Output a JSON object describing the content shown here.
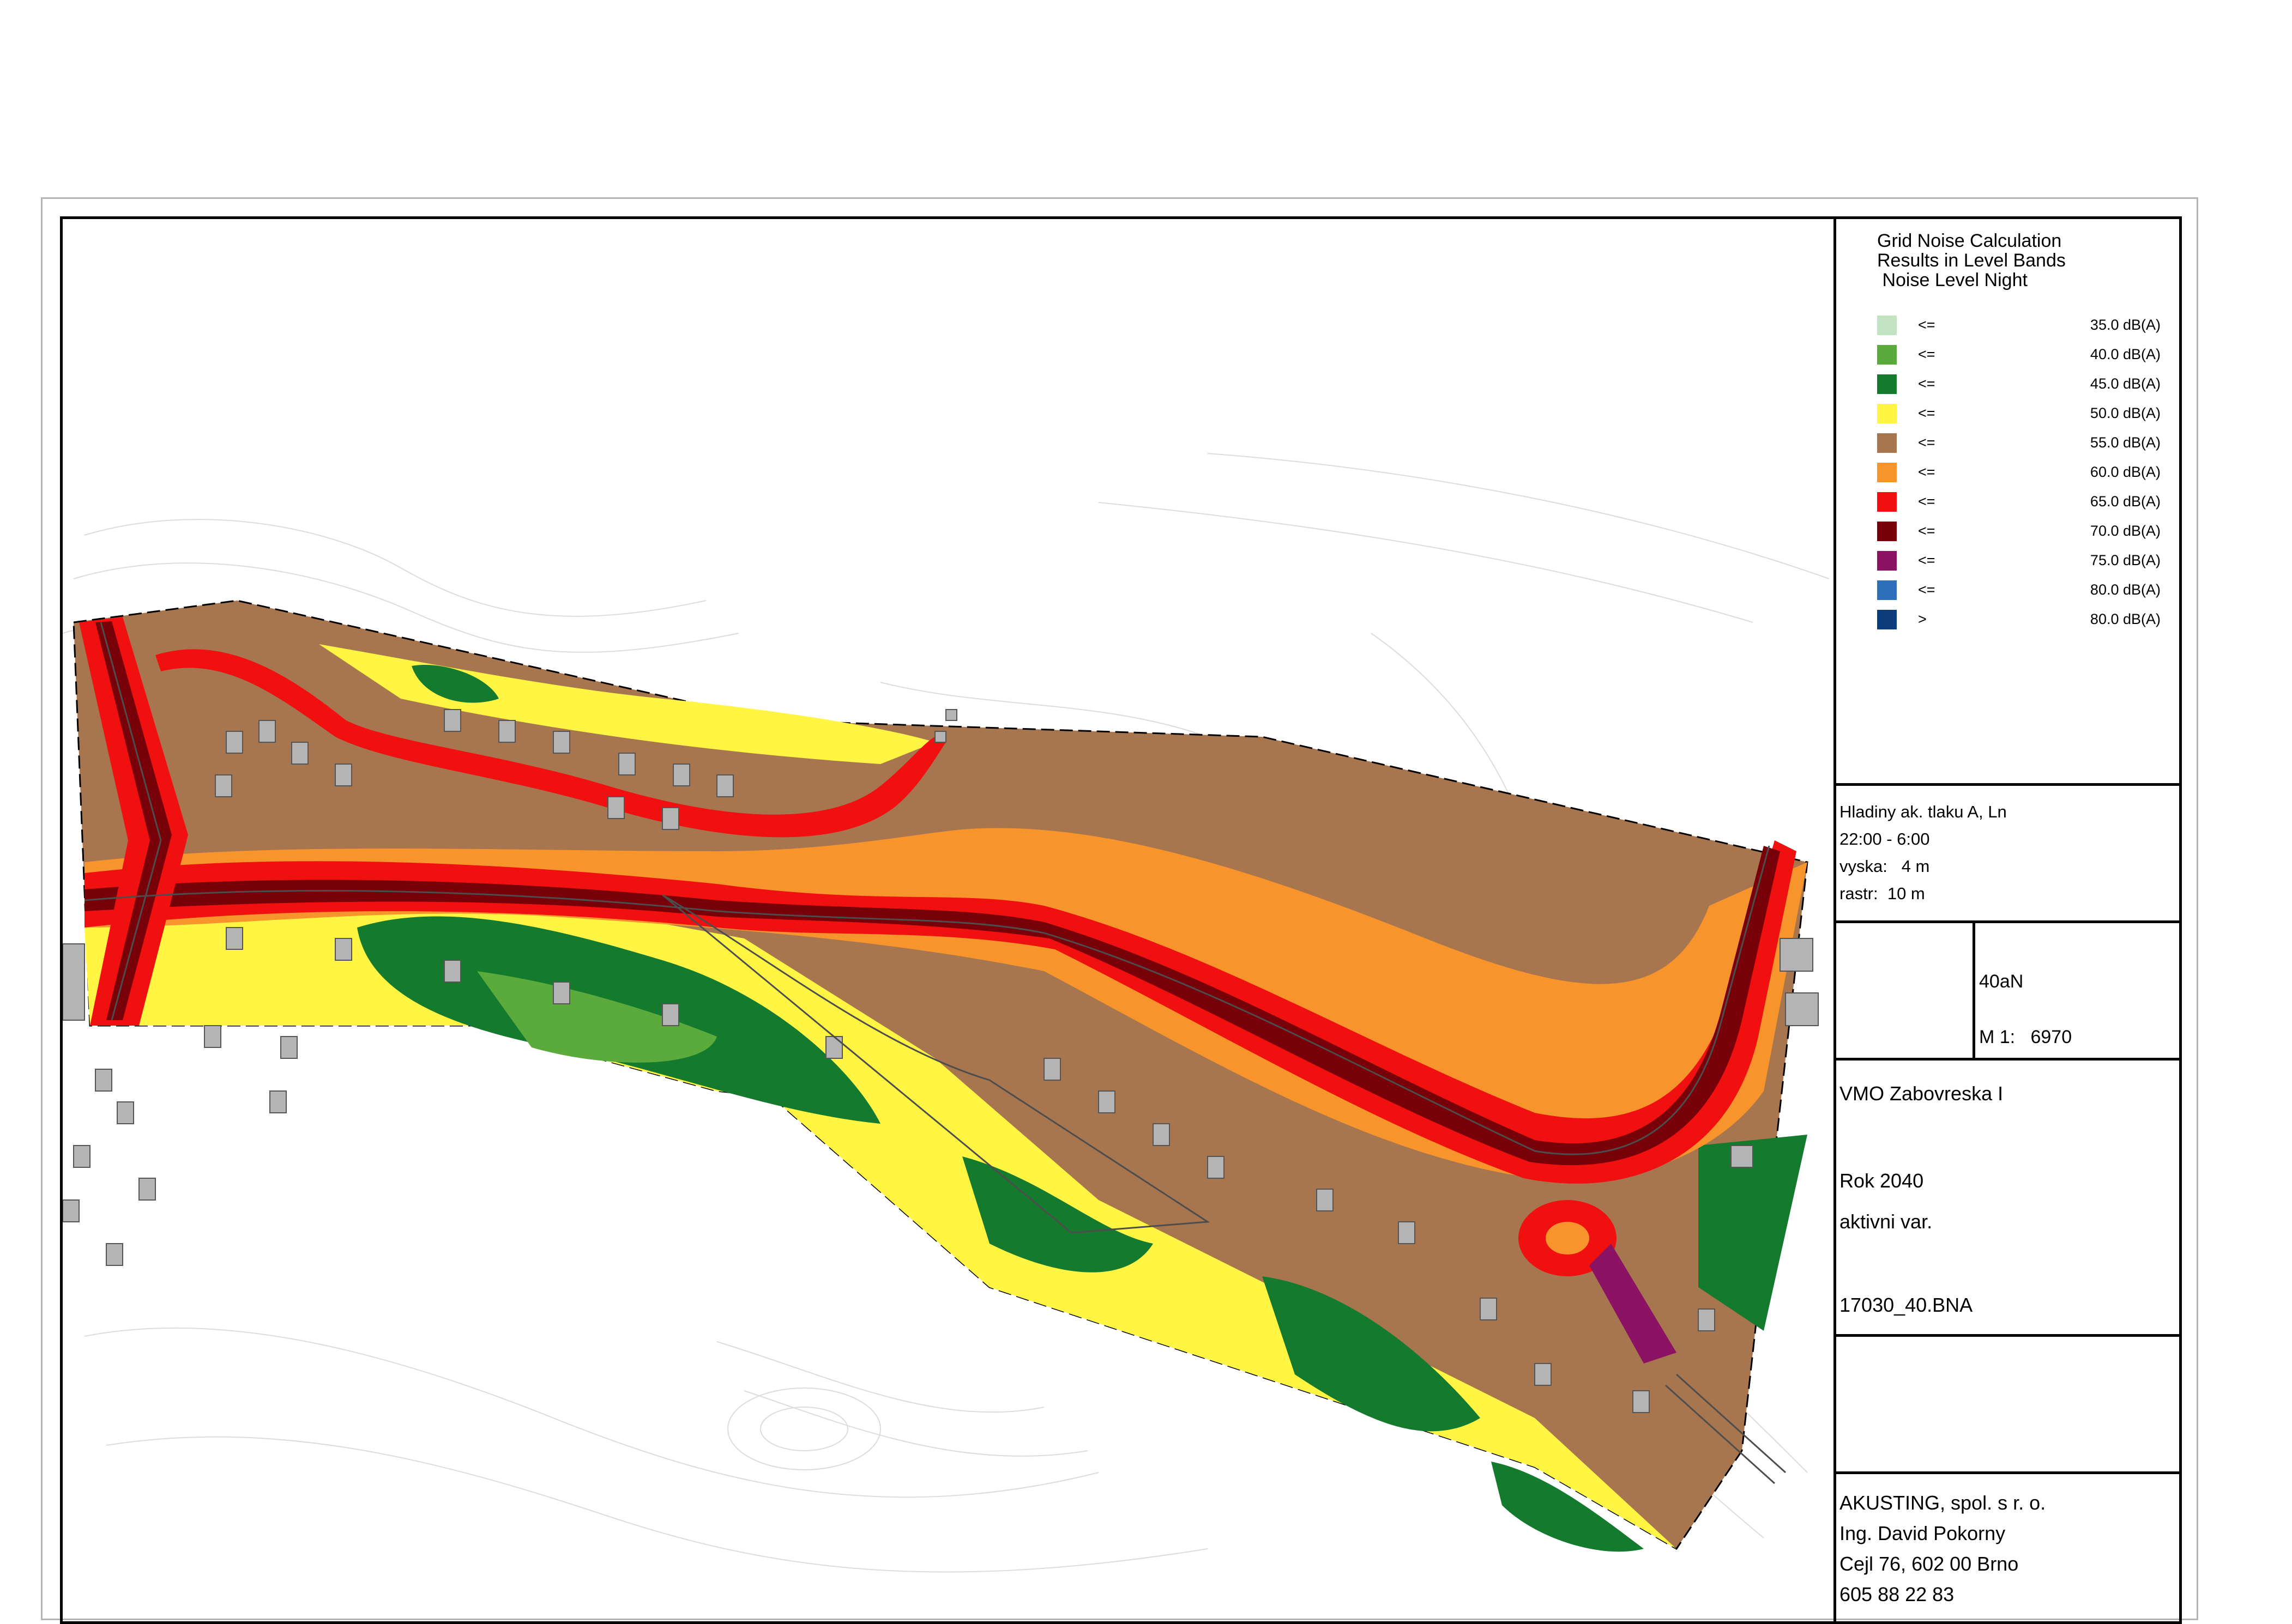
{
  "legend": {
    "title_line1": "Grid Noise Calculation",
    "title_line2": "Results in Level Bands",
    "title_line3": " Noise Level Night",
    "bands": [
      {
        "op": "<=",
        "value": "35.0 dB(A)",
        "color": "#c2e3c2"
      },
      {
        "op": "<=",
        "value": "40.0 dB(A)",
        "color": "#5aaa3c"
      },
      {
        "op": "<=",
        "value": "45.0 dB(A)",
        "color": "#147a2e"
      },
      {
        "op": "<=",
        "value": "50.0 dB(A)",
        "color": "#fff542"
      },
      {
        "op": "<=",
        "value": "55.0 dB(A)",
        "color": "#a8764e"
      },
      {
        "op": "<=",
        "value": "60.0 dB(A)",
        "color": "#f7942c"
      },
      {
        "op": "<=",
        "value": "65.0 dB(A)",
        "color": "#f01010"
      },
      {
        "op": "<=",
        "value": "70.0 dB(A)",
        "color": "#780008"
      },
      {
        "op": "<=",
        "value": "75.0 dB(A)",
        "color": "#8c1264"
      },
      {
        "op": "<=",
        "value": "80.0 dB(A)",
        "color": "#2d6fb8"
      },
      {
        "op": ">",
        "value": "80.0 dB(A)",
        "color": "#0c3c7c"
      }
    ]
  },
  "params": {
    "line1": "Hladiny ak. tlaku A, Ln",
    "line2": "22:00 - 6:00",
    "line3": "vyska:   4 m",
    "line4": "rastr:  10 m"
  },
  "variant": {
    "code": "40aN",
    "scale": "M 1:   6970"
  },
  "project": {
    "name": "VMO Zabovreska I",
    "year": "Rok 2040",
    "variant": "aktivni var.",
    "file": "17030_40.BNA"
  },
  "company": {
    "line1": "AKUSTING, spol. s r. o.",
    "line2": "Ing. David Pokorny",
    "line3": "Cejl 76, 602 00 Brno",
    "line4": "605 88 22 83"
  }
}
